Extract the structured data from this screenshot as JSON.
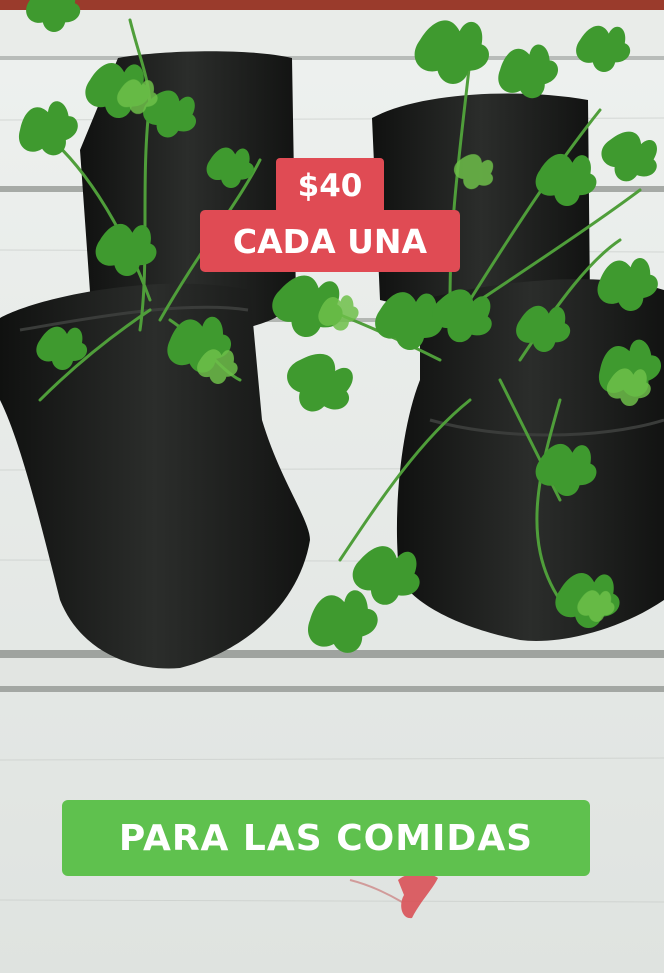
{
  "image": {
    "description_colors": {
      "table_surface": "#e7eae8",
      "plank_gap": "#9fa39f",
      "bag": "#1b1c1b",
      "leaf": "#3f9a2f",
      "leaf_light": "#6ec04a"
    }
  },
  "overlays": {
    "price": {
      "amount": "$40",
      "unit_text": "CADA UNA",
      "background": "#e04b54"
    },
    "footer": {
      "text": "PARA LAS COMIDAS",
      "background": "#5fc14e"
    }
  },
  "icons": [
    "potted-seedling-bag",
    "parsley-leaf"
  ]
}
